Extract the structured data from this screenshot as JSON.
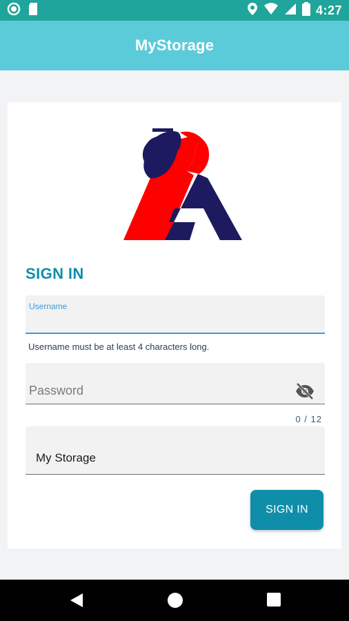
{
  "status_bar": {
    "time": "4:27",
    "icons": [
      "sync-icon",
      "sd-card-icon",
      "location-icon",
      "wifi-icon",
      "signal-icon",
      "battery-icon"
    ],
    "color": "#1fa59b"
  },
  "app_bar": {
    "title": "MyStorage",
    "color": "#5ccbd9"
  },
  "form": {
    "title": "SIGN IN",
    "username": {
      "label": "Username",
      "value": "",
      "helper": "Username must be at least 4 characters long."
    },
    "password": {
      "placeholder": "Password",
      "counter": "0 / 12",
      "toggle_icon": "eye-off-icon"
    },
    "storage": {
      "value": "My Storage"
    },
    "submit_label": "SIGN IN",
    "accent_color": "#0f8ea9"
  },
  "logo": {
    "colors": [
      "#ff0000",
      "#1e1a60"
    ],
    "icon": "handshake-a-logo"
  },
  "nav_bar": {
    "icons": [
      "back-icon",
      "home-icon",
      "recents-icon"
    ]
  }
}
